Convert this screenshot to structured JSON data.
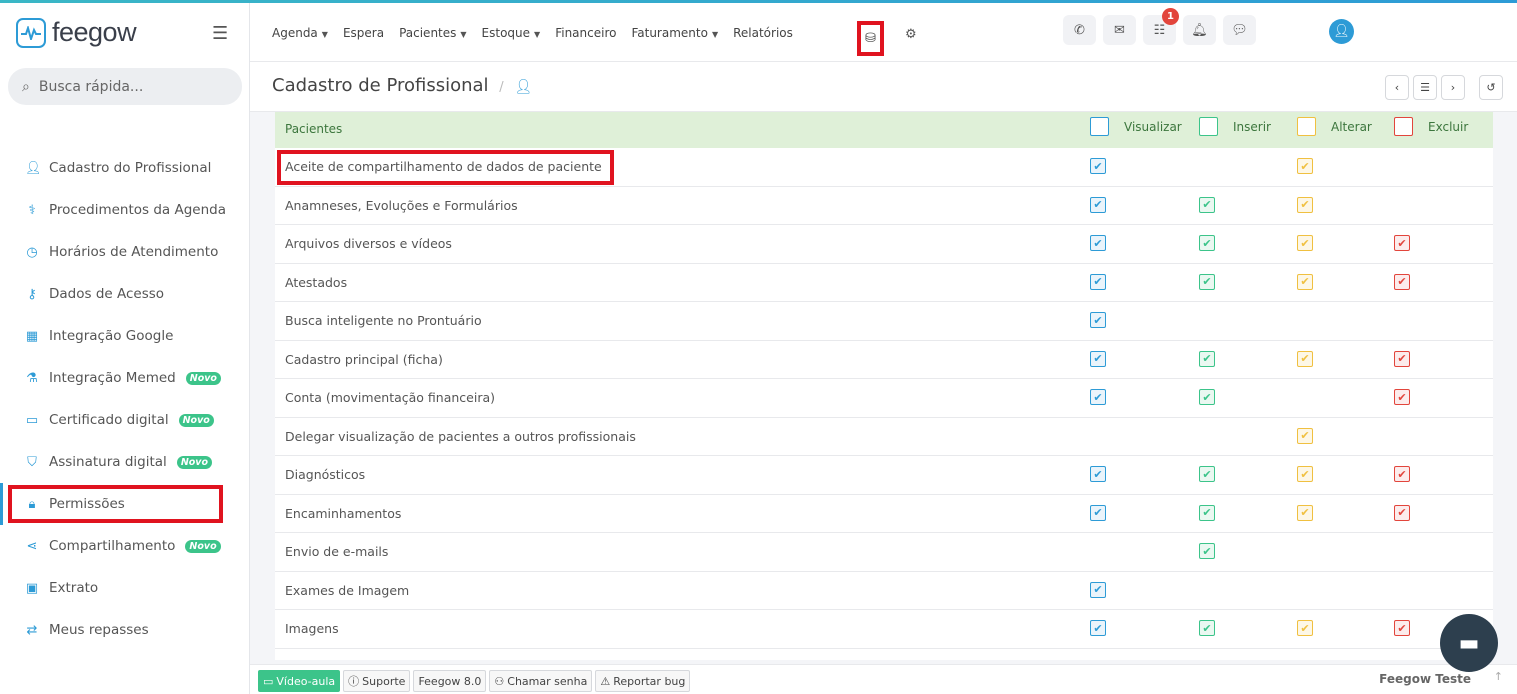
{
  "brand": {
    "logo_text": "feegow"
  },
  "search": {
    "placeholder": "Busca rápida..."
  },
  "nav": {
    "links": [
      {
        "label": "Agenda",
        "dropdown": true
      },
      {
        "label": "Espera",
        "dropdown": false
      },
      {
        "label": "Pacientes",
        "dropdown": true
      },
      {
        "label": "Estoque",
        "dropdown": true
      },
      {
        "label": "Financeiro",
        "dropdown": false
      },
      {
        "label": "Faturamento",
        "dropdown": true
      },
      {
        "label": "Relatórios",
        "dropdown": false
      }
    ],
    "notification_count": "1"
  },
  "sidebar": {
    "items": [
      {
        "label": "Cadastro do Profissional",
        "icon": "user-icon",
        "badge": ""
      },
      {
        "label": "Procedimentos da Agenda",
        "icon": "stethoscope-icon",
        "badge": ""
      },
      {
        "label": "Horários de Atendimento",
        "icon": "clock-icon",
        "badge": ""
      },
      {
        "label": "Dados de Acesso",
        "icon": "key-icon",
        "badge": ""
      },
      {
        "label": "Integração Google",
        "icon": "calendar-icon",
        "badge": ""
      },
      {
        "label": "Integração Memed",
        "icon": "flask-icon",
        "badge": "Novo"
      },
      {
        "label": "Certificado digital",
        "icon": "card-icon",
        "badge": "Novo"
      },
      {
        "label": "Assinatura digital",
        "icon": "shield-icon",
        "badge": "Novo"
      },
      {
        "label": "Permissões",
        "icon": "lock-icon",
        "badge": ""
      },
      {
        "label": "Compartilhamento",
        "icon": "share-icon",
        "badge": "Novo"
      },
      {
        "label": "Extrato",
        "icon": "money-icon",
        "badge": ""
      },
      {
        "label": "Meus repasses",
        "icon": "exchange-icon",
        "badge": ""
      }
    ]
  },
  "page": {
    "title": "Cadastro de Profissional",
    "separator": "/"
  },
  "table": {
    "section": "Pacientes",
    "columns": {
      "view": "Visualizar",
      "insert": "Inserir",
      "edit": "Alterar",
      "delete": "Excluir"
    },
    "rows": [
      {
        "label": "Aceite de compartilhamento de dados de paciente",
        "v": true,
        "i": false,
        "a": true,
        "e": false
      },
      {
        "label": "Anamneses, Evoluções e Formulários",
        "v": true,
        "i": true,
        "a": true,
        "e": false
      },
      {
        "label": "Arquivos diversos e vídeos",
        "v": true,
        "i": true,
        "a": true,
        "e": true
      },
      {
        "label": "Atestados",
        "v": true,
        "i": true,
        "a": true,
        "e": true
      },
      {
        "label": "Busca inteligente no Prontuário",
        "v": true,
        "i": false,
        "a": false,
        "e": false
      },
      {
        "label": "Cadastro principal (ficha)",
        "v": true,
        "i": true,
        "a": true,
        "e": true
      },
      {
        "label": "Conta (movimentação financeira)",
        "v": true,
        "i": true,
        "a": false,
        "e": true
      },
      {
        "label": "Delegar visualização de pacientes a outros profissionais",
        "v": false,
        "i": false,
        "a": true,
        "e": false
      },
      {
        "label": "Diagnósticos",
        "v": true,
        "i": true,
        "a": true,
        "e": true
      },
      {
        "label": "Encaminhamentos",
        "v": true,
        "i": true,
        "a": true,
        "e": true
      },
      {
        "label": "Envio de e-mails",
        "v": false,
        "i": true,
        "a": false,
        "e": false
      },
      {
        "label": "Exames de Imagem",
        "v": true,
        "i": false,
        "a": false,
        "e": false
      },
      {
        "label": "Imagens",
        "v": true,
        "i": true,
        "a": true,
        "e": true
      }
    ]
  },
  "footer": {
    "video": "Vídeo-aula",
    "support": "Suporte",
    "version": "Feegow 8.0",
    "call": "Chamar senha",
    "bug": "Reportar bug",
    "user": "Feegow Teste"
  },
  "colors": {
    "accent": "#2d9bd6",
    "green": "#3cc48a",
    "yellow": "#f0c040",
    "red": "#e2453c",
    "highlight": "#e0131f"
  }
}
